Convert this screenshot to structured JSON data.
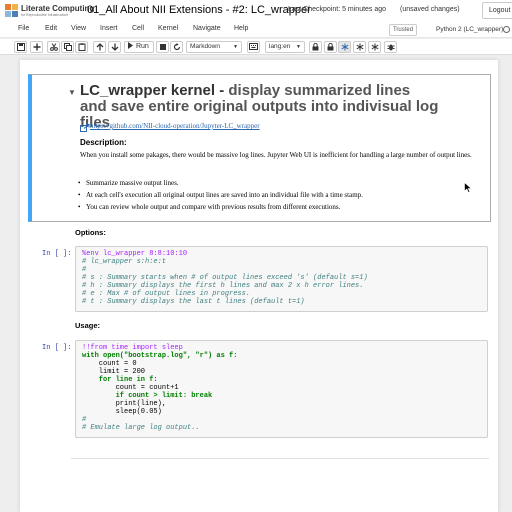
{
  "header": {
    "logo_name": "Literate Computing",
    "logo_tagline": "for Reproducible Infrastructure",
    "notebook_name": "01_All About NII Extensions - #2: LC_wrapper",
    "checkpoint": "Last Checkpoint: 5 minutes ago",
    "autosave": "(unsaved changes)",
    "logout_label": "Logout"
  },
  "menubar": {
    "items": [
      "File",
      "Edit",
      "View",
      "Insert",
      "Cell",
      "Kernel",
      "Navigate",
      "Help"
    ],
    "trusted": "Trusted",
    "kernel": "Python 2 (LC_wrapper)"
  },
  "toolbar": {
    "run_label": "Run",
    "cell_type": "Markdown",
    "lang": "lang:en",
    "icons": [
      "save-icon",
      "plus-icon",
      "cut-icon",
      "copy-icon",
      "paste-icon",
      "arrow-up-icon",
      "arrow-down-icon",
      "run-icon",
      "stop-icon",
      "restart-icon",
      "keyboard-icon",
      "lock-icon",
      "freeze-icon",
      "bug-icon"
    ]
  },
  "cells": {
    "md1": {
      "title_main": "LC_wrapper kernel - ",
      "title_sub": "display summarized lines and save entire original outputs into indivisual log files",
      "link": "https://github.com/NII-cloud-operation/Jupyter-LC_wrapper",
      "desc_heading": "Description:",
      "desc": "When you install some pakages, there would be massive log lines. Jupyter Web UI is inefficient for handling a large number of output lines.",
      "bullets": [
        "Summarize massive output lines.",
        "At each cell's execution all original output lines are saved into an individual file with a time stamp.",
        "You can review whole output and compare with previous results from different executions."
      ]
    },
    "options_heading": "Options:",
    "code1": {
      "prompt": "In [ ]:",
      "lines": [
        "%env lc_wrapper 8:8:10:10",
        "# lc_wrapper s:h:e:t",
        "#",
        "# s : Summary starts when # of output lines exceed 's' (default s=1)",
        "# h : Summary displays the first h lines and max 2 x h error lines.",
        "# e : Max # of output lines in progress.",
        "# t : Summary displays the last t lines (default t=1)"
      ]
    },
    "usage_heading": "Usage:",
    "code2": {
      "prompt": "In [ ]:",
      "lines": [
        "!!from time import sleep",
        "with open(\"bootstrap.log\", \"r\") as f:",
        "    count = 0",
        "    limit = 200",
        "    for line in f:",
        "        count = count+1",
        "        if count > limit: break",
        "        print(line),",
        "        sleep(0.05)",
        "#",
        "# Emulate large log output.."
      ]
    }
  },
  "colors": {
    "selected_border": "#42a5f5",
    "link": "#2b67b1",
    "prompt": "#303f9f"
  }
}
